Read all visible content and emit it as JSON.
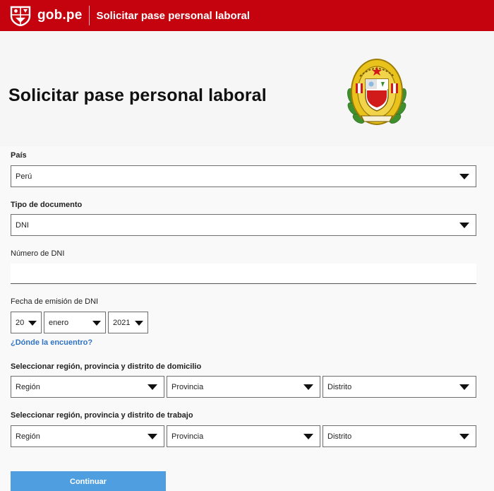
{
  "header": {
    "brand": "gob.pe",
    "app_title": "Solicitar pase personal laboral",
    "logo_icon": "peru-shield-icon",
    "bg_color": "#c4030f"
  },
  "page": {
    "title": "Solicitar pase personal laboral",
    "crest_icon": "policia-nacional-crest-icon"
  },
  "form": {
    "pais": {
      "label": "País",
      "value": "Perú"
    },
    "tipo_documento": {
      "label": "Tipo de documento",
      "value": "DNI"
    },
    "numero_dni": {
      "label": "Número de DNI",
      "value": ""
    },
    "fecha_emision": {
      "label": "Fecha de emisión de DNI",
      "day": "20",
      "month": "enero",
      "year": "2021"
    },
    "donde_link": "¿Dónde la encuentro?",
    "domicilio": {
      "label": "Seleccionar región, provincia y distrito de domicilio",
      "region": "Región",
      "provincia": "Provincia",
      "distrito": "Distrito"
    },
    "trabajo": {
      "label": "Seleccionar región, provincia y distrito de trabajo",
      "region": "Región",
      "provincia": "Provincia",
      "distrito": "Distrito"
    },
    "continuar": "Continuar"
  }
}
